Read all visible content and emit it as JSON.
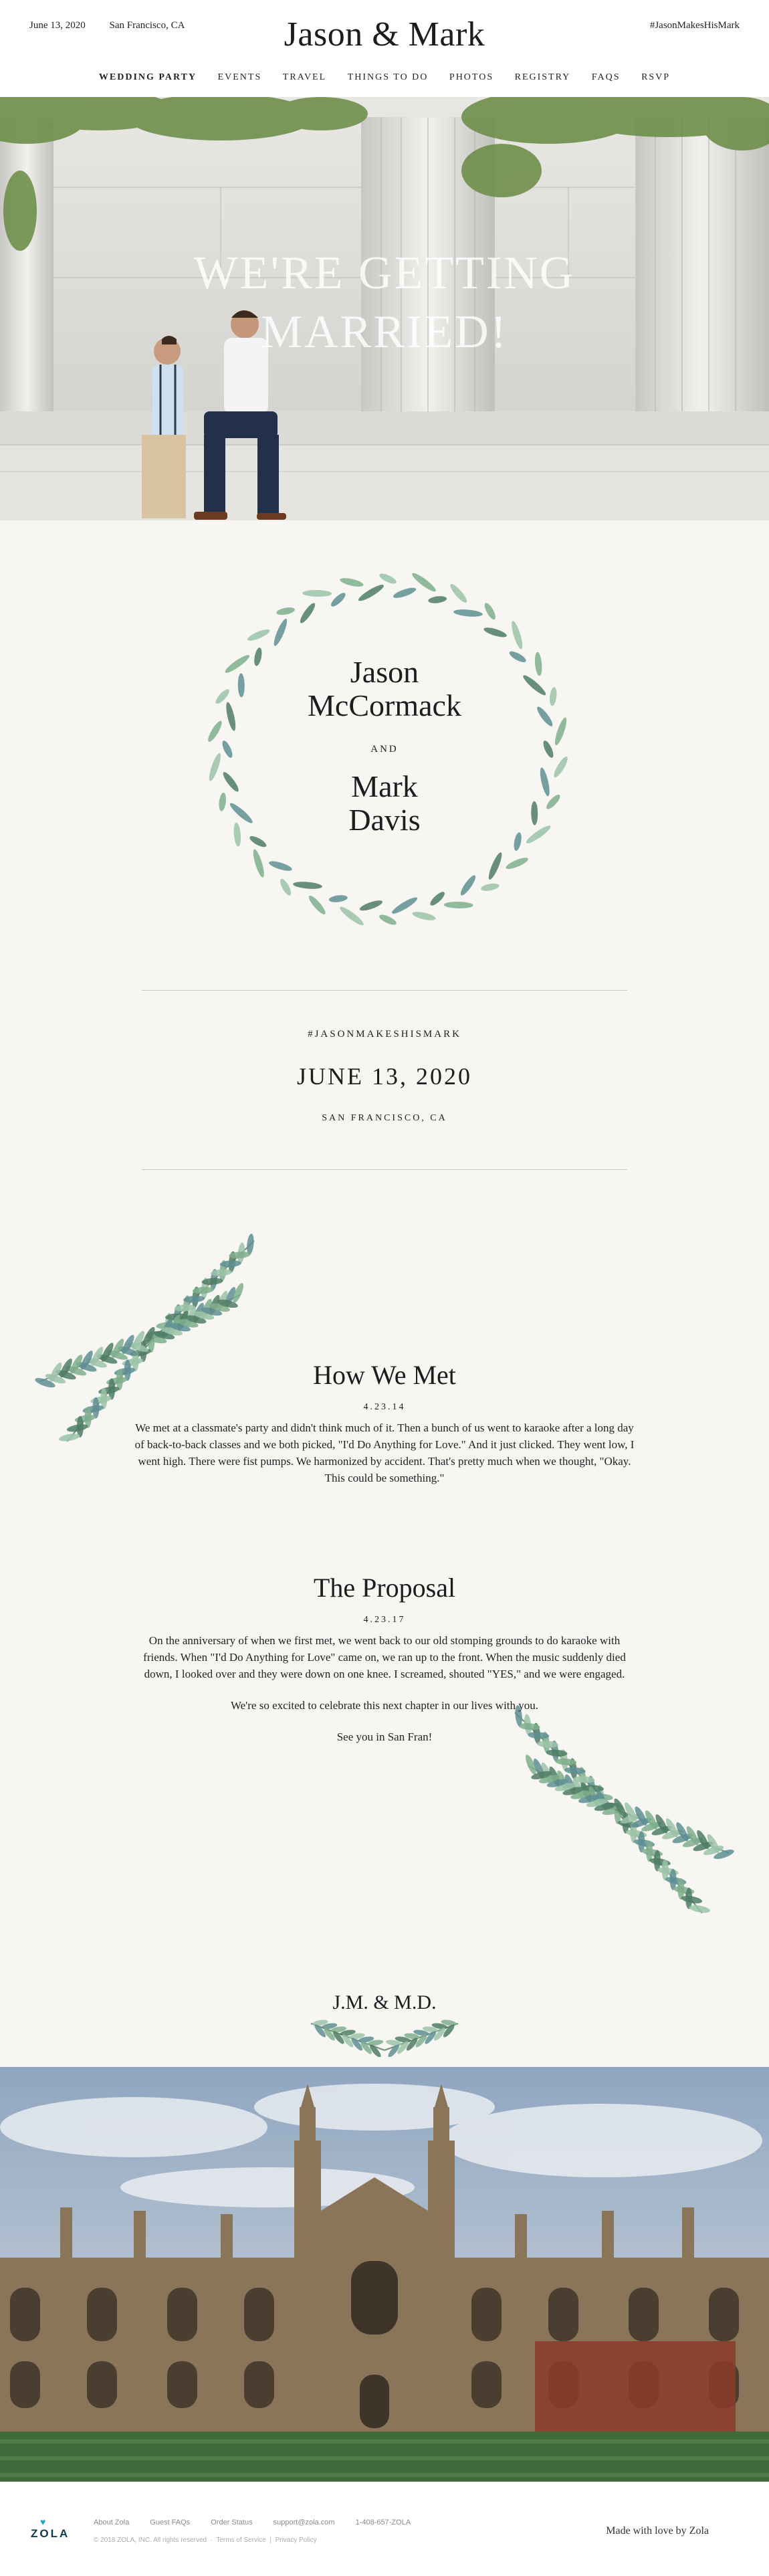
{
  "header": {
    "date": "June 13, 2020",
    "location": "San Francisco, CA",
    "title": "Jason & Mark",
    "hashtag": "#JasonMakesHisMark"
  },
  "nav": {
    "items": [
      "Wedding Party",
      "Events",
      "Travel",
      "Things To Do",
      "Photos",
      "Registry",
      "FAQs",
      "RSVP"
    ]
  },
  "hero": {
    "line1": "We're getting",
    "line2": "married!"
  },
  "couple": {
    "name1_first": "Jason",
    "name1_last": "McCormack",
    "and_word": "and",
    "name2_first": "Mark",
    "name2_last": "Davis"
  },
  "event": {
    "hashtag": "#JasonMakesHisMark",
    "date": "June 13, 2020",
    "location": "San Francisco, CA"
  },
  "how_we_met": {
    "title": "How We Met",
    "date": "4.23.14",
    "body": "We met at a classmate's party and didn't think much of it. Then a bunch of us went to karaoke after a long day of back-to-back classes and we both picked, \"I'd Do Anything for Love.\" And it just clicked. They went low, I went high. There were fist pumps. We harmonized by accident. That's pretty much when we thought, \"Okay. This could be something.\""
  },
  "proposal": {
    "title": "The Proposal",
    "date": "4.23.17",
    "body": "On the anniversary of when we first met, we went back to our old stomping grounds to do karaoke with friends. When \"I'd Do Anything for Love\" came on, we ran up to the front. When the music suddenly died down, I looked over and they were down on one knee. I screamed, shouted \"YES,\" and we were engaged.",
    "excited": "We're so excited to celebrate this next chapter in our lives with you.",
    "see_you": "See you in San Fran!"
  },
  "monogram": "J.M. & M.D.",
  "footer": {
    "logo": "ZOLA",
    "links": [
      "About Zola",
      "Guest FAQs",
      "Order Status",
      "support@zola.com",
      "1-408-657-ZOLA"
    ],
    "copyright": "© 2018 ZOLA, INC. All rights reserved",
    "terms": "Terms of Service",
    "privacy": "Privacy Policy",
    "made_with": "Made with love by Zola"
  },
  "colors": {
    "background": "#f8f6f3",
    "leaf_dark": "#4f7d64",
    "leaf_light": "#9cc3a7",
    "leaf_blue": "#5f8f93"
  }
}
